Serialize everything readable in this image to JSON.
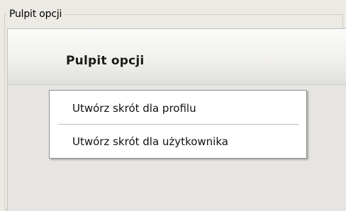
{
  "groupbox": {
    "legend": "Pulpit opcji"
  },
  "panel": {
    "title": "Pulpit opcji"
  },
  "context_menu": {
    "items": [
      {
        "label": "Utwórz skrót dla profilu"
      },
      {
        "label": "Utwórz skrót dla użytkownika"
      }
    ]
  }
}
